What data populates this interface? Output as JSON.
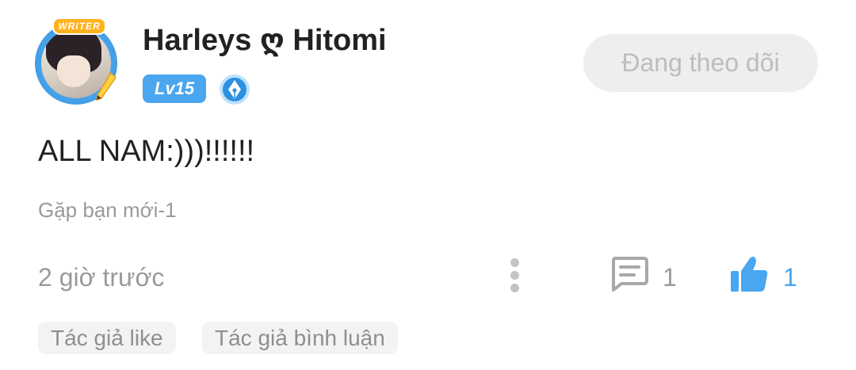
{
  "user": {
    "name": "Harleys ღ Hitomi",
    "avatar_badge": "WRITER",
    "level": "Lv15"
  },
  "follow_button_label": "Đang theo dõi",
  "post": {
    "text": "ALL NAM:)))!!!!!!",
    "group": "Gặp bạn mới-1",
    "time": "2 giờ trước",
    "comment_count": "1",
    "like_count": "1"
  },
  "tags": [
    "Tác giả like",
    "Tác giả bình luận"
  ],
  "colors": {
    "accent": "#4aa6ef",
    "muted_text": "#9a9a9a",
    "button_bg": "#eeeeee",
    "badge_orange": "#ffb21e"
  },
  "icons": {
    "more": "more-vertical-icon",
    "comment": "comment-icon",
    "like": "thumbs-up-icon",
    "pen_badge": "pen-nib-icon"
  }
}
